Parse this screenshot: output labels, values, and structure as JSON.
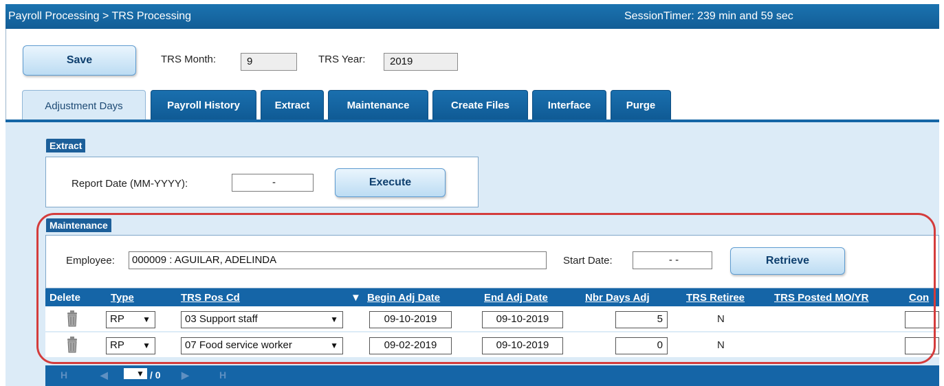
{
  "header": {
    "breadcrumb": "Payroll Processing > TRS Processing",
    "session_timer": "SessionTimer: 239 min and 59 sec"
  },
  "toolbar": {
    "save_label": "Save",
    "trs_month_label": "TRS Month:",
    "trs_month_value": "9",
    "trs_year_label": "TRS Year:",
    "trs_year_value": "2019"
  },
  "tabs": [
    {
      "label": "Adjustment Days",
      "active": true
    },
    {
      "label": "Payroll History"
    },
    {
      "label": "Extract"
    },
    {
      "label": "Maintenance"
    },
    {
      "label": "Create Files"
    },
    {
      "label": "Interface"
    },
    {
      "label": "Purge"
    }
  ],
  "extract": {
    "legend": "Extract",
    "report_date_label": "Report Date (MM-YYYY):",
    "report_date_value": "-",
    "execute_label": "Execute"
  },
  "maintenance": {
    "legend": "Maintenance",
    "employee_label": "Employee:",
    "employee_value": "000009 : AGUILAR, ADELINDA",
    "start_date_label": "Start Date:",
    "start_date_value": "- -",
    "retrieve_label": "Retrieve"
  },
  "grid": {
    "columns": [
      "Delete",
      "Type",
      "TRS Pos Cd",
      "Begin Adj Date",
      "End Adj Date",
      "Nbr Days Adj",
      "TRS Retiree",
      "TRS Posted MO/YR",
      "Con"
    ],
    "sort_indicator": "▼",
    "rows": [
      {
        "type": "RP",
        "pos": "03 Support staff",
        "begin": "09-10-2019",
        "end": "09-10-2019",
        "days": "5",
        "retiree": "N"
      },
      {
        "type": "RP",
        "pos": "07 Food service worker",
        "begin": "09-02-2019",
        "end": "09-10-2019",
        "days": "0",
        "retiree": "N"
      }
    ]
  },
  "pager": {
    "first": "H",
    "prev": "◀",
    "page_select": "▼",
    "page_total": "/ 0",
    "next": "▶",
    "last": "H"
  },
  "colors": {
    "accent": "#1565a7",
    "highlight": "#d43c3c"
  }
}
